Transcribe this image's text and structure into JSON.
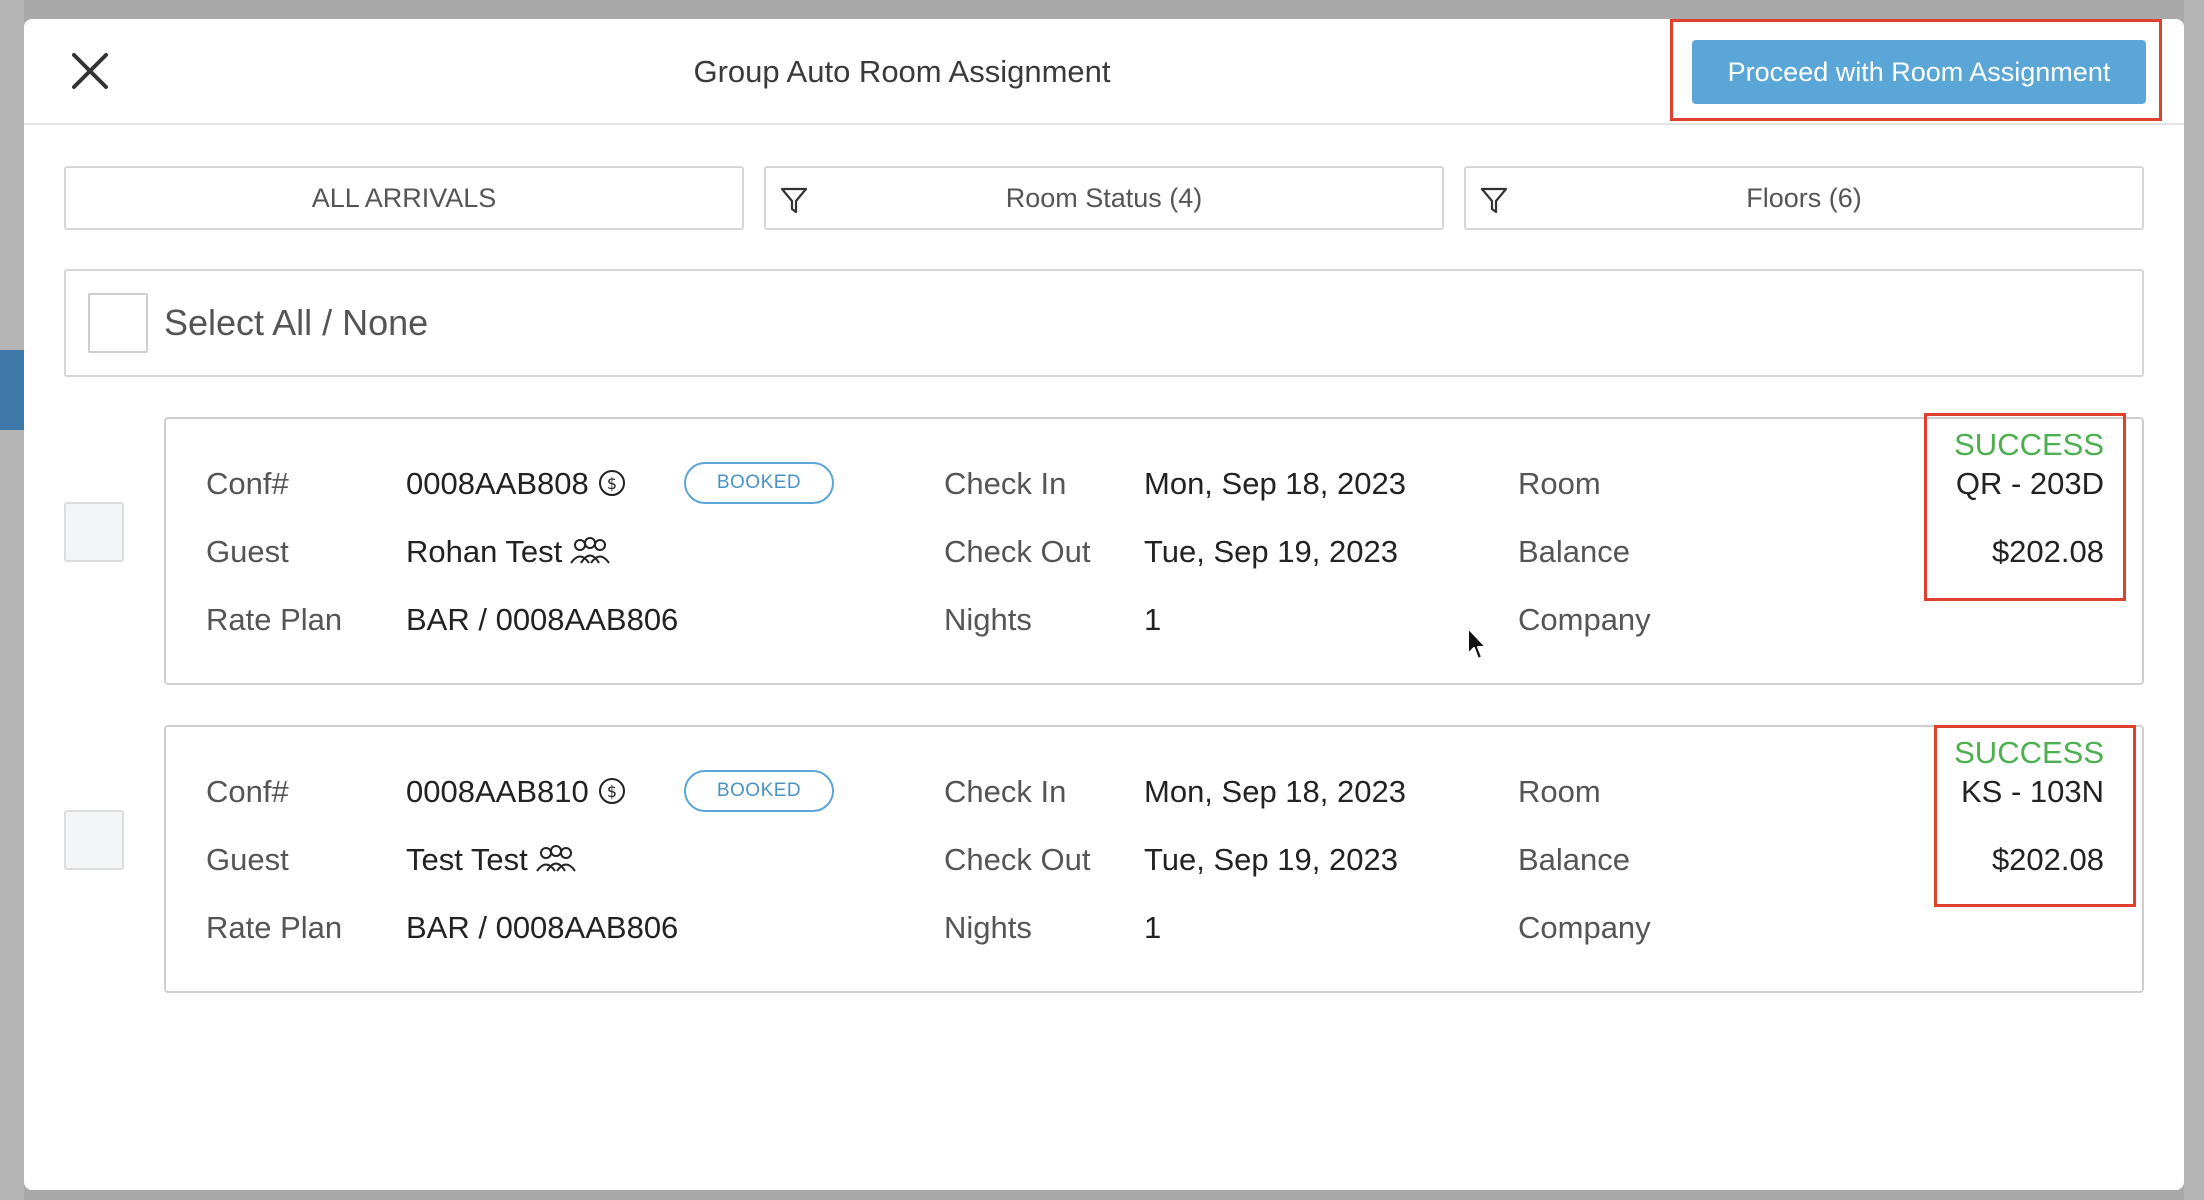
{
  "modal": {
    "title": "Group Auto Room Assignment",
    "proceed_label": "Proceed with Room Assignment"
  },
  "filters": {
    "arrivals": "ALL ARRIVALS",
    "room_status": "Room Status (4)",
    "floors": "Floors (6)"
  },
  "select_all_label": "Select All / None",
  "labels": {
    "conf": "Conf#",
    "guest": "Guest",
    "rate_plan": "Rate Plan",
    "check_in": "Check In",
    "check_out": "Check Out",
    "nights": "Nights",
    "room": "Room",
    "balance": "Balance",
    "company": "Company"
  },
  "reservations": [
    {
      "conf": "0008AAB808",
      "status": "BOOKED",
      "guest": "Rohan Test",
      "rate_plan": "BAR / 0008AAB806",
      "check_in": "Mon, Sep 18, 2023",
      "check_out": "Tue, Sep 19, 2023",
      "nights": "1",
      "result": "SUCCESS",
      "room": "QR - 203D",
      "balance": "$202.08"
    },
    {
      "conf": "0008AAB810",
      "status": "BOOKED",
      "guest": "Test Test",
      "rate_plan": "BAR / 0008AAB806",
      "check_in": "Mon, Sep 18, 2023",
      "check_out": "Tue, Sep 19, 2023",
      "nights": "1",
      "result": "SUCCESS",
      "room": "KS - 103N",
      "balance": "$202.08"
    }
  ],
  "colors": {
    "accent": "#5aa6d6",
    "success": "#4caf50",
    "highlight": "#e0402e"
  },
  "icons": [
    "close-icon",
    "filter-icon",
    "dollar-circle-icon",
    "group-icon",
    "mouse-cursor-icon"
  ]
}
